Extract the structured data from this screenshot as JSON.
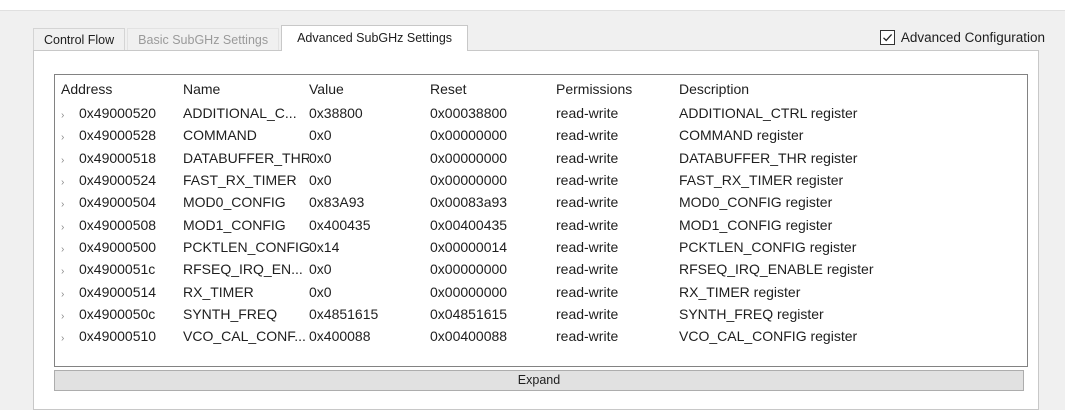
{
  "tabs": [
    {
      "label": "Control Flow"
    },
    {
      "label": "Basic SubGHz Settings"
    },
    {
      "label": "Advanced SubGHz Settings"
    }
  ],
  "advanced_config": {
    "label": "Advanced Configuration",
    "checked": true
  },
  "table": {
    "headers": {
      "address": "Address",
      "name": "Name",
      "value": "Value",
      "reset": "Reset",
      "permissions": "Permissions",
      "description": "Description"
    },
    "rows": [
      {
        "address": "0x49000520",
        "name": "ADDITIONAL_C...",
        "value": "0x38800",
        "reset": "0x00038800",
        "permissions": "read-write",
        "description": "ADDITIONAL_CTRL register"
      },
      {
        "address": "0x49000528",
        "name": "COMMAND",
        "value": "0x0",
        "reset": "0x00000000",
        "permissions": "read-write",
        "description": "COMMAND register"
      },
      {
        "address": "0x49000518",
        "name": "DATABUFFER_THR",
        "value": "0x0",
        "reset": "0x00000000",
        "permissions": "read-write",
        "description": "DATABUFFER_THR register"
      },
      {
        "address": "0x49000524",
        "name": "FAST_RX_TIMER",
        "value": "0x0",
        "reset": "0x00000000",
        "permissions": "read-write",
        "description": "FAST_RX_TIMER register"
      },
      {
        "address": "0x49000504",
        "name": "MOD0_CONFIG",
        "value": "0x83A93",
        "reset": "0x00083a93",
        "permissions": "read-write",
        "description": "MOD0_CONFIG register"
      },
      {
        "address": "0x49000508",
        "name": "MOD1_CONFIG",
        "value": "0x400435",
        "reset": "0x00400435",
        "permissions": "read-write",
        "description": "MOD1_CONFIG register"
      },
      {
        "address": "0x49000500",
        "name": "PCKTLEN_CONFIG",
        "value": "0x14",
        "reset": "0x00000014",
        "permissions": "read-write",
        "description": "PCKTLEN_CONFIG register"
      },
      {
        "address": "0x4900051c",
        "name": "RFSEQ_IRQ_EN...",
        "value": "0x0",
        "reset": "0x00000000",
        "permissions": "read-write",
        "description": "RFSEQ_IRQ_ENABLE register"
      },
      {
        "address": "0x49000514",
        "name": "RX_TIMER",
        "value": "0x0",
        "reset": "0x00000000",
        "permissions": "read-write",
        "description": "RX_TIMER register"
      },
      {
        "address": "0x4900050c",
        "name": "SYNTH_FREQ",
        "value": "0x4851615",
        "reset": "0x04851615",
        "permissions": "read-write",
        "description": "SYNTH_FREQ register"
      },
      {
        "address": "0x49000510",
        "name": "VCO_CAL_CONF...",
        "value": "0x400088",
        "reset": "0x00400088",
        "permissions": "read-write",
        "description": "VCO_CAL_CONFIG register"
      }
    ]
  },
  "expand_button": {
    "label": "Expand"
  },
  "icons": {
    "row_expander": "chevron-right-icon",
    "checkbox": "checkmark-icon"
  }
}
